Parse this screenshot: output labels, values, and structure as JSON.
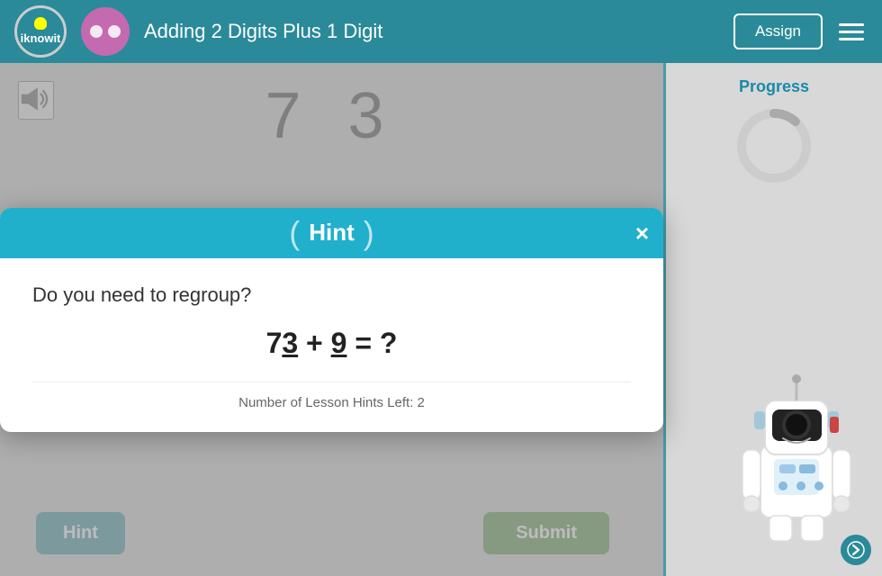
{
  "header": {
    "logo_text": "iknowit",
    "lesson_title": "Adding 2 Digits Plus 1 Digit",
    "assign_label": "Assign",
    "hamburger_aria": "Menu"
  },
  "content": {
    "sound_aria": "Sound",
    "math_top": "7  3",
    "hint_button_label": "Hint",
    "submit_button_label": "Submit"
  },
  "sidebar": {
    "progress_label": "Progress",
    "progress_percent": 0
  },
  "hint_modal": {
    "title": "Hint",
    "close_aria": "×",
    "question_text": "Do you need to regroup?",
    "equation_display": "73 + 9 = ?",
    "hints_left_label": "Number of Lesson Hints Left: 2"
  }
}
